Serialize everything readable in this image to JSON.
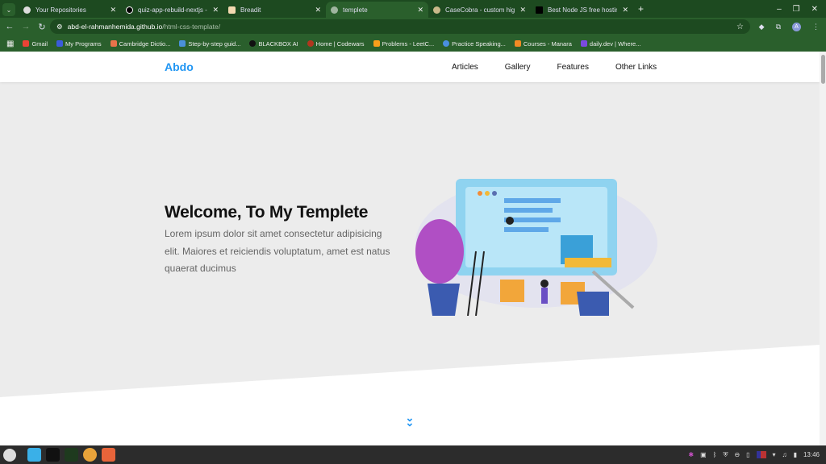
{
  "browser": {
    "tabs": [
      {
        "title": "Your Repositories",
        "icon": "github-icon",
        "active": false
      },
      {
        "title": "quiz-app-rebuild-nextjs - Ove",
        "icon": "vercel-icon",
        "active": false
      },
      {
        "title": "Breadit",
        "icon": "breadit-icon",
        "active": false
      },
      {
        "title": "templete",
        "icon": "globe-icon",
        "active": true
      },
      {
        "title": "CaseCobra - custom high-qu",
        "icon": "casecobra-icon",
        "active": false
      },
      {
        "title": "Best Node JS free hosting se",
        "icon": "dev-icon",
        "active": false
      }
    ],
    "new_tab": "+",
    "url_domain": "abd-el-rahmanhemida.github.io",
    "url_path": "/html-css-template/",
    "avatar_letter": "A",
    "bookmarks": [
      {
        "label": "Gmail",
        "color": "#ea4335"
      },
      {
        "label": "My Programs",
        "color": "#3b5bdb"
      },
      {
        "label": "Cambridge Dictio...",
        "color": "#e8734a"
      },
      {
        "label": "Step-by-step guid...",
        "color": "#4a90d9"
      },
      {
        "label": "BLACKBOX AI",
        "color": "#111111"
      },
      {
        "label": "Home | Codewars",
        "color": "#b1361e"
      },
      {
        "label": "Problems - LeetC...",
        "color": "#f89f1b"
      },
      {
        "label": "Practice Speaking...",
        "color": "#4a8fe0"
      },
      {
        "label": "Courses - Manara",
        "color": "#f08a24"
      },
      {
        "label": "daily.dev | Where...",
        "color": "#7b4ae0"
      }
    ]
  },
  "site": {
    "logo": "Abdo",
    "nav": [
      "Articles",
      "Gallery",
      "Features",
      "Other Links"
    ],
    "hero_title": "Welcome, To My Templete",
    "hero_text": "Lorem ipsum dolor sit amet consectetur adipisicing elit. Maiores et reiciendis voluptatum, amet est natus quaerat ducimus",
    "accent": "#2196f3"
  },
  "taskbar": {
    "clock": "13:46"
  }
}
